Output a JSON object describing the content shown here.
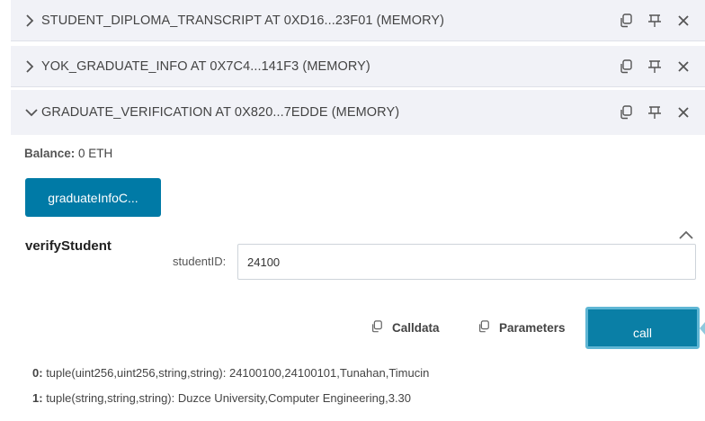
{
  "contracts": [
    {
      "title": "STUDENT_DIPLOMA_TRANSCRIPT AT 0XD16...23F01 (MEMORY)",
      "expanded": false
    },
    {
      "title": "YOK_GRADUATE_INFO AT 0X7C4...141F3 (MEMORY)",
      "expanded": false
    },
    {
      "title": "GRADUATE_VERIFICATION AT 0X820...7EDDE (MEMORY)",
      "expanded": true
    }
  ],
  "icons": {
    "collapsed": "chevron-right-icon",
    "expanded": "chevron-down-icon",
    "copy": "copy-icon",
    "pin": "pin-icon",
    "close": "close-icon"
  },
  "balance": {
    "label": "Balance:",
    "value": "0 ETH"
  },
  "function_button": {
    "label": "graduateInfoC..."
  },
  "function": {
    "name": "verifyStudent",
    "param_label": "studentID:",
    "param_value": "24100",
    "calldata_label": "Calldata",
    "parameters_label": "Parameters",
    "call_label": "call"
  },
  "outputs": [
    {
      "index": "0:",
      "text": "tuple(uint256,uint256,string,string): 24100100,24100101,Tunahan,Timucin"
    },
    {
      "index": "1:",
      "text": "tuple(string,string,string): Duzce University,Computer Engineering,3.30"
    }
  ],
  "colors": {
    "accent": "#007aa6",
    "row_bg": "#f1f2f7"
  }
}
